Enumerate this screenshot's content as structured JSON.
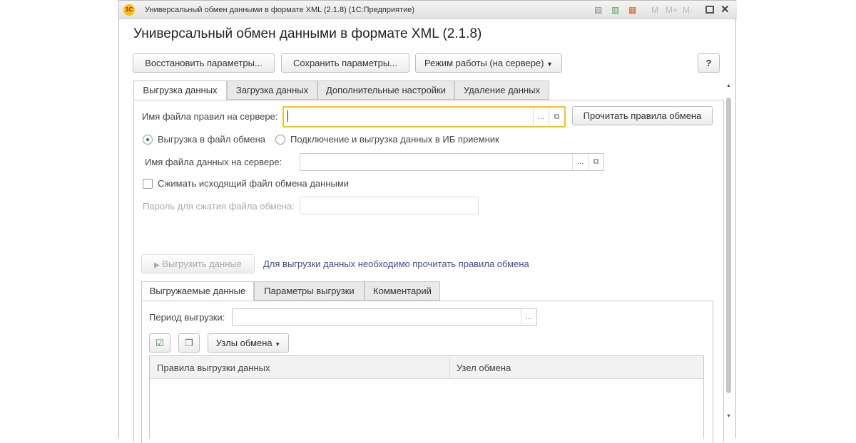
{
  "window": {
    "title": "Универсальный обмен данными в формате XML (2.1.8)  (1С:Предприятие)",
    "logo": "1С",
    "toolbar_icons": [
      "print-preview-icon",
      "calculator-icon",
      "calendar-icon"
    ],
    "memory": [
      "M",
      "M+",
      "M-"
    ]
  },
  "header": {
    "title": "Универсальный обмен данными в формате XML (2.1.8)"
  },
  "toolbar": {
    "restore": "Восстановить параметры...",
    "save": "Сохранить параметры...",
    "mode": "Режим работы (на сервере)",
    "help": "?"
  },
  "tabs": [
    "Выгрузка данных",
    "Загрузка данных",
    "Дополнительные настройки",
    "Удаление данных"
  ],
  "form": {
    "rules_file_label": "Имя файла правил на сервере:",
    "rules_file_value": "",
    "read_rules": "Прочитать правила обмена",
    "radio_file": "Выгрузка в файл обмена",
    "radio_connect": "Подключение и выгрузка данных в ИБ приемник",
    "data_file_label": "Имя файла данных на сервере:",
    "data_file_value": "",
    "compress_label": "Сжимать исходящий файл обмена данными",
    "compress_checked": false,
    "password_label": "Пароль для сжатия файла обмена:",
    "password_value": "",
    "export_button": "Выгрузить данные",
    "export_hint": "Для выгрузки данных необходимо прочитать правила обмена",
    "ellipsis": "...",
    "open": "⧉"
  },
  "subtabs": [
    "Выгружаемые данные",
    "Параметры выгрузки",
    "Комментарий"
  ],
  "sub": {
    "period_label": "Период выгрузки:",
    "period_value": "",
    "nodes_button": "Узлы обмена",
    "columns": [
      "Правила выгрузки данных",
      "Узел обмена"
    ]
  }
}
